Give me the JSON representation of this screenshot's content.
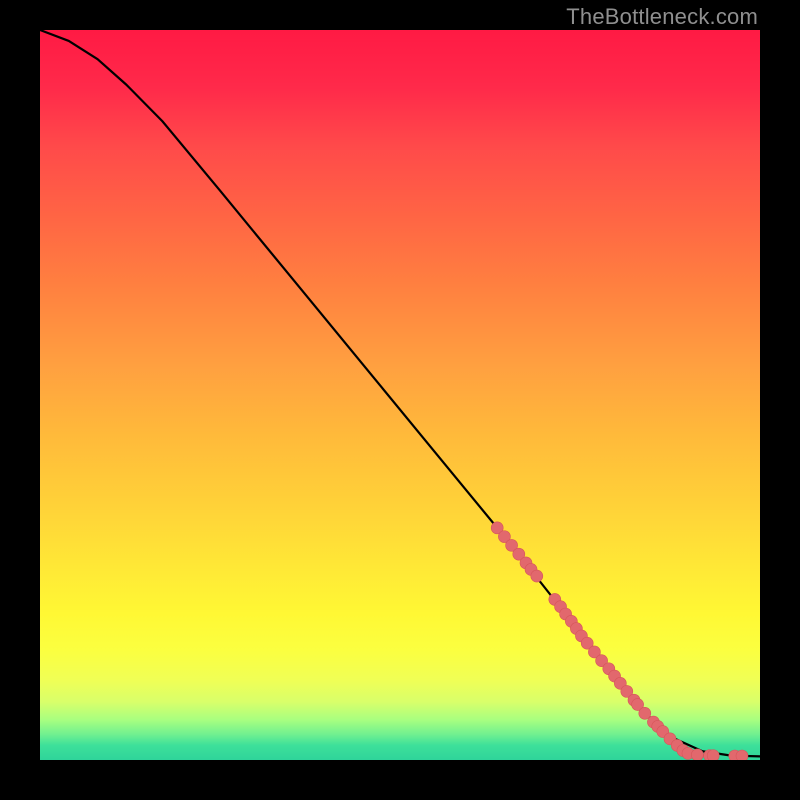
{
  "watermark": "TheBottleneck.com",
  "chart_data": {
    "type": "line",
    "title": "",
    "xlabel": "",
    "ylabel": "",
    "xlim": [
      0,
      100
    ],
    "ylim": [
      0,
      100
    ],
    "grid": false,
    "background_gradient": {
      "direction": "vertical",
      "stops": [
        {
          "pos": 0.0,
          "color": "#ff1a44"
        },
        {
          "pos": 0.35,
          "color": "#ff8040"
        },
        {
          "pos": 0.66,
          "color": "#ffd438"
        },
        {
          "pos": 0.85,
          "color": "#f0ff55"
        },
        {
          "pos": 0.96,
          "color": "#70f090"
        },
        {
          "pos": 1.0,
          "color": "#2fd49a"
        }
      ]
    },
    "series": [
      {
        "name": "curve",
        "x": [
          0,
          4,
          8,
          12,
          17,
          25,
          35,
          45,
          55,
          65,
          73,
          78,
          82,
          85,
          88,
          92,
          96,
          100
        ],
        "y": [
          100,
          98.5,
          96,
          92.5,
          87.5,
          78,
          66,
          54,
          42,
          30,
          20,
          14,
          9,
          5.5,
          3,
          1.2,
          0.6,
          0.5
        ]
      }
    ],
    "points": {
      "name": "highlighted-segment",
      "color": "#e2686d",
      "x": [
        63.5,
        64.5,
        65.5,
        66.5,
        67.5,
        68.2,
        69.0,
        71.5,
        72.3,
        73.0,
        73.8,
        74.5,
        75.2,
        76.0,
        77.0,
        78.0,
        79.0,
        79.8,
        80.6,
        81.5,
        82.5,
        83.0,
        84.0,
        85.2,
        85.8,
        86.5,
        87.5,
        88.5,
        89.3,
        90.0,
        91.3,
        93.0,
        93.5,
        96.5,
        97.5
      ],
      "y": [
        31.8,
        30.6,
        29.4,
        28.2,
        27.0,
        26.1,
        25.2,
        22.0,
        21.0,
        20.0,
        19.0,
        18.0,
        17.0,
        16.0,
        14.8,
        13.6,
        12.5,
        11.5,
        10.5,
        9.4,
        8.2,
        7.6,
        6.4,
        5.2,
        4.6,
        3.9,
        2.9,
        2.0,
        1.3,
        0.9,
        0.7,
        0.6,
        0.6,
        0.55,
        0.55
      ]
    }
  }
}
